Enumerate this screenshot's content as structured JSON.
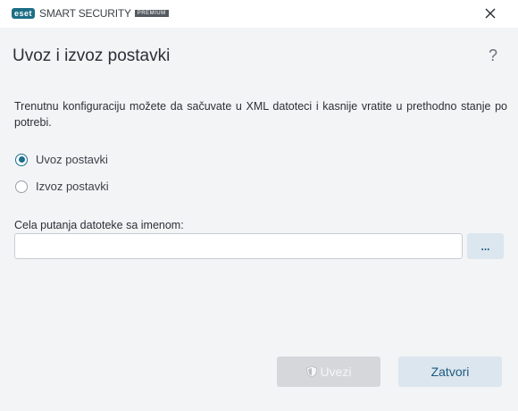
{
  "titlebar": {
    "brand": "eset",
    "product": "SMART SECURITY",
    "edition": "PREMIUM",
    "close_icon": "close-icon"
  },
  "dialog": {
    "title": "Uvoz i izvoz postavki",
    "help": "?",
    "description": "Trenutnu konfiguraciju možete da sačuvate u XML datoteci i kasnije vratite u prethodno stanje po potrebi."
  },
  "options": [
    {
      "label": "Uvoz postavki",
      "checked": true
    },
    {
      "label": "Izvoz postavki",
      "checked": false
    }
  ],
  "path_field": {
    "label": "Cela putanja datoteke sa imenom:",
    "value": "",
    "browse_label": "..."
  },
  "buttons": {
    "import_label": "Uvezi",
    "import_icon": "shield-icon",
    "import_disabled": true,
    "close_label": "Zatvori"
  },
  "colors": {
    "accent": "#1b6f8c",
    "brand": "#1c6e86",
    "button_secondary_bg": "#dce6ee",
    "button_disabled_bg": "#d5d7da"
  }
}
